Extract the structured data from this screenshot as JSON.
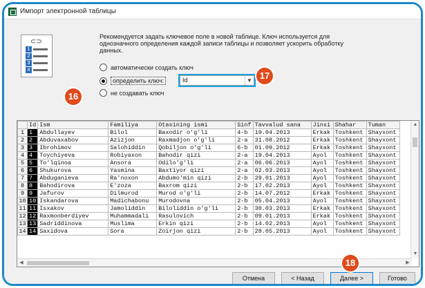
{
  "window": {
    "title": "Импорт электронной таблицы"
  },
  "intro_text": "Рекомендуется задать ключевое поле в новой таблице. Ключ используется для однозначного определения каждой записи таблицы и позволяет ускорить обработку данных.",
  "icon_rows": [
    "1",
    "2",
    "3",
    "4"
  ],
  "options": {
    "auto": "автоматически создать ключ",
    "define": "определить ключ:",
    "none": "не создавать ключ",
    "selected": "define"
  },
  "key_field": {
    "value": "Id"
  },
  "badges": {
    "b16": "16",
    "b17": "17",
    "b18": "18"
  },
  "colors": {
    "frame": "#1c88c8",
    "badge": "#e04a1c",
    "select_highlight": "#1ba1e2"
  },
  "table": {
    "columns": [
      "Id",
      "Ism",
      "Familiya",
      "Otasining ismi",
      "Sinf",
      "Tavvalud sana",
      "Jinsi",
      "Shahar",
      "Tuman"
    ],
    "rows": [
      [
        "1",
        "1",
        "Abdullayev",
        "Bilol",
        "Baxodir o'g'li",
        "4-b",
        "19.04.2013",
        "Erkak",
        "Toshkent",
        "Shayxont"
      ],
      [
        "2",
        "2",
        "Abduvaxabov",
        "Azizjon",
        "Raxmadjon o'g'li",
        "2-a",
        "31.08.2012",
        "Erkak",
        "Toshkent",
        "Shayxont"
      ],
      [
        "3",
        "3",
        "Ibrohimov",
        "Salohiddin",
        "Qobiljon o'g'li",
        "6-b",
        "01.09.2012",
        "Erkak",
        "Toshkent",
        "Shayxont"
      ],
      [
        "4",
        "4",
        "Toychiyeva",
        "Robiyaxon",
        "Bahodir qizi",
        "2-a",
        "19.04.2013",
        "Ayol",
        "Toshkent",
        "Shayxont"
      ],
      [
        "5",
        "5",
        "To'lqinoa",
        "Ansora",
        "Odilo'g'li",
        "2-a",
        "06.06.2013",
        "Ayol",
        "Toshkent",
        "Shayxont"
      ],
      [
        "6",
        "6",
        "Shukurova",
        "Yasmina",
        "Baxtiyor qizi",
        "2-a",
        "02.03.2013",
        "Ayol",
        "Toshkent",
        "Shayxont"
      ],
      [
        "7",
        "7",
        "Abduganieva",
        "Ra'noxon",
        "Abdumo'min qizi",
        "2-b",
        "29.01.2013",
        "Ayol",
        "Toshkent",
        "Shayxont"
      ],
      [
        "8",
        "8",
        "Bahodirova",
        "E'zoza",
        "Baxrom qizi",
        "2-b",
        "17.02.2013",
        "Ayol",
        "Toshkent",
        "Shayxont"
      ],
      [
        "9",
        "9",
        "Jafurov",
        "Dilmurod",
        "Murod o'g'li",
        "2-b",
        "14.07.2012",
        "Erkak",
        "Toshkent",
        "Shayxont"
      ],
      [
        "10",
        "10",
        "Iskandarova",
        "Madichabonu",
        "Murodovna",
        "2-b",
        "05.04.2013",
        "Ayol",
        "Toshkent",
        "Shayxont"
      ],
      [
        "11",
        "11",
        "Isxakov",
        "Jamoliddin",
        "Biloliddin o'g'li",
        "2-b",
        "30.03.2013",
        "Erkak",
        "Toshkent",
        "Shayxont"
      ],
      [
        "12",
        "12",
        "Raxmonberdiyev",
        "Muhammadali",
        "Rasulovich",
        "2-b",
        "09.01.2013",
        "Erkak",
        "Toshkent",
        "Shayxont"
      ],
      [
        "13",
        "13",
        "Sadriddinova",
        "Muslima",
        "Erkin qizi",
        "2-b",
        "14.02.2013",
        "Ayol",
        "Toshkent",
        "Shayxont"
      ],
      [
        "14",
        "14",
        "Saxidova",
        "Sora",
        "Zoirjon qizi",
        "2-b",
        "28.05.2013",
        "Ayol",
        "Toshkent",
        "Shayxont"
      ]
    ]
  },
  "buttons": {
    "cancel": "Отмена",
    "back": "< Назад",
    "next": "Далее >",
    "finish": "Готово"
  }
}
